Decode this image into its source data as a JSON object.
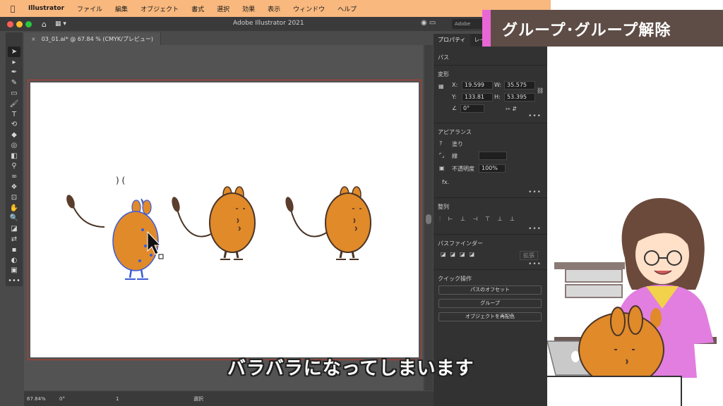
{
  "menubar": {
    "app_name": "Illustrator",
    "items": [
      "ファイル",
      "編集",
      "オブジェクト",
      "書式",
      "選択",
      "効果",
      "表示",
      "ウィンドウ",
      "ヘルプ"
    ]
  },
  "window": {
    "title": "Adobe Illustrator 2021",
    "search_placeholder": "Adobe"
  },
  "document": {
    "tab_label": "03_01.ai* @ 67.84 % (CMYK/プレビュー)"
  },
  "statusbar": {
    "zoom": "67.84%",
    "rotation": "0°",
    "artboard_number": "1",
    "mode": "選択"
  },
  "panel": {
    "tabs": [
      "プロパティ",
      "レイ"
    ],
    "object_type": "パス",
    "transform": {
      "header": "変形",
      "x_label": "X:",
      "x_value": "19.599",
      "y_label": "Y:",
      "y_value": "133.81",
      "w_label": "W:",
      "w_value": "35.575",
      "h_label": "H:",
      "h_value": "53.395",
      "angle_value": "0°"
    },
    "appearance": {
      "header": "アピアランス",
      "fill_label": "塗り",
      "stroke_label": "線",
      "opacity_label": "不透明度",
      "opacity_value": "100%",
      "fx_label": "fx."
    },
    "align": {
      "header": "整列"
    },
    "pathfinder": {
      "header": "パスファインダー",
      "expand_label": "拡張"
    },
    "quick_actions": {
      "header": "クイック操作",
      "buttons": [
        "パスのオフセット",
        "グループ",
        "オブジェクトを再配色"
      ]
    }
  },
  "overlay": {
    "title": "グループ･グループ解除",
    "subtitle": "バラバラになってしまいます",
    "accent_color": "#e867d6",
    "banner_color": "#5e4d46"
  },
  "colors": {
    "character_orange": "#e08a2a",
    "selection_blue": "#3a5bd9",
    "outline": "#4a3426"
  }
}
